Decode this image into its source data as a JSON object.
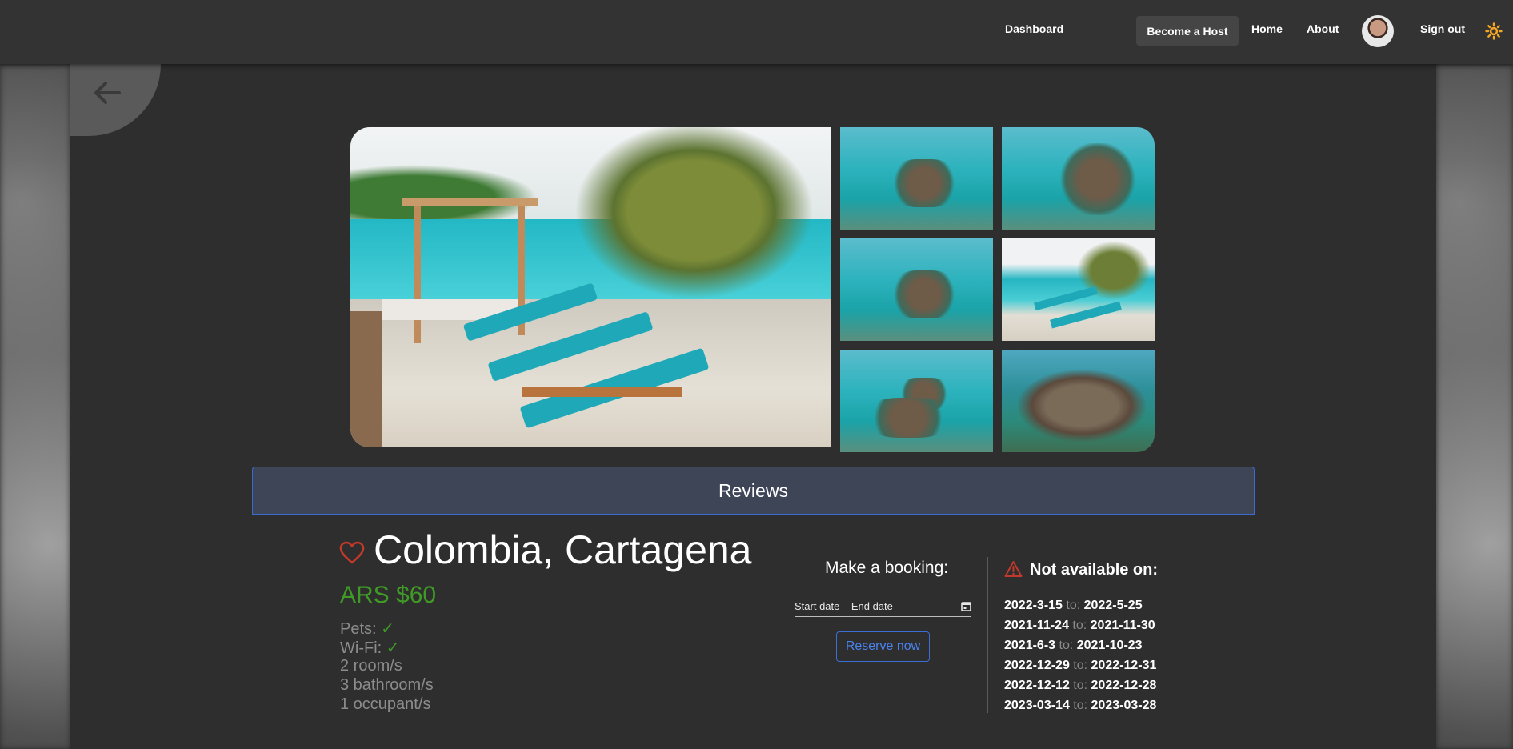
{
  "nav": {
    "dashboard": "Dashboard",
    "become_host": "Become a Host",
    "home": "Home",
    "about": "About",
    "sign_out": "Sign out",
    "theme_icon": "sun-icon",
    "avatar": "user-avatar"
  },
  "back": {
    "icon": "arrow-left-icon"
  },
  "gallery": {
    "main_photo": "beach-loungers-photo",
    "thumbnails": [
      "aerial-hut-1",
      "aerial-hut-2",
      "aerial-hut-3",
      "beach-loungers-2",
      "aerial-island",
      "aerial-house"
    ]
  },
  "reviews": {
    "label": "Reviews"
  },
  "listing": {
    "title": "Colombia, Cartagena",
    "price": "ARS $60",
    "pets_label": "Pets:",
    "pets_value": "✓",
    "wifi_label": "Wi-Fi:",
    "wifi_value": "✓",
    "rooms": "2 room/s",
    "bathrooms": "3 bathroom/s",
    "occupants": "1 occupant/s"
  },
  "booking": {
    "title": "Make a booking:",
    "date_placeholder": "Start date – End date",
    "reserve_label": "Reserve now"
  },
  "availability": {
    "title": "Not available on:",
    "to_label": "to:",
    "ranges": [
      {
        "start": "2022-3-15",
        "end": "2022-5-25"
      },
      {
        "start": "2021-11-24",
        "end": "2021-11-30"
      },
      {
        "start": "2021-6-3",
        "end": "2021-10-23"
      },
      {
        "start": "2022-12-29",
        "end": "2022-12-31"
      },
      {
        "start": "2022-12-12",
        "end": "2022-12-28"
      },
      {
        "start": "2023-03-14",
        "end": "2023-03-28"
      }
    ]
  },
  "colors": {
    "accent_blue": "#3b6fd6",
    "price_green": "#3f9a26",
    "heart_red": "#c0392b",
    "theme_icon": "#f5a623"
  }
}
